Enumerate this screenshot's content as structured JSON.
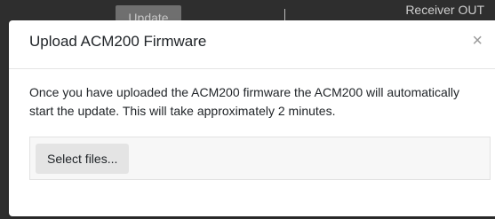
{
  "background": {
    "button_label": "Update",
    "right_text": "Receiver OUT"
  },
  "modal": {
    "title": "Upload ACM200 Firmware",
    "close_label": "×",
    "body_text": "Once you have uploaded the ACM200 firmware the ACM200 will automatically start the update. This will take approximately 2 minutes.",
    "select_button_label": "Select files..."
  }
}
